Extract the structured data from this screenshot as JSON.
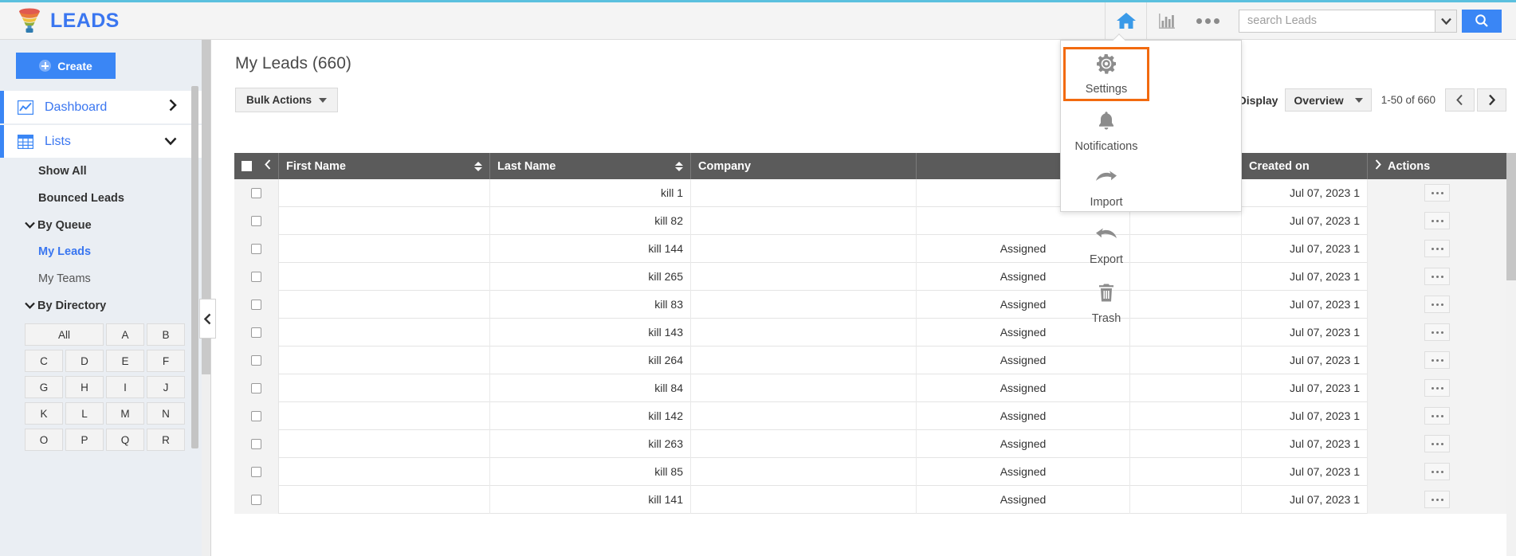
{
  "app": {
    "brand": "LEADS",
    "brand_color": "#3a76f0",
    "accent_color": "#3a86f5",
    "highlight_color": "#f26a0f",
    "top_border_color": "#5bc0de"
  },
  "topbar": {
    "home_icon": "home-icon",
    "reports_icon": "bar-chart-icon",
    "more_icon": "three-dots-icon",
    "search": {
      "placeholder": "search Leads",
      "value": "",
      "caret_icon": "chevron-down-icon",
      "submit_icon": "search-icon"
    }
  },
  "more_menu": {
    "items": [
      {
        "label": "Settings",
        "icon": "gear-icon",
        "selected": true
      },
      {
        "label": "Notifications",
        "icon": "bell-icon",
        "selected": false
      },
      {
        "label": "Import",
        "icon": "import-arrow-icon",
        "selected": false
      },
      {
        "label": "Export",
        "icon": "export-arrow-icon",
        "selected": false
      },
      {
        "label": "Trash",
        "icon": "trash-icon",
        "selected": false
      }
    ]
  },
  "sidebar": {
    "create_label": "Create",
    "nav": [
      {
        "label": "Dashboard",
        "icon": "line-chart-icon",
        "chevron": "›",
        "active": true
      },
      {
        "label": "Lists",
        "icon": "grid-icon",
        "chevron": "⌄",
        "active": true
      }
    ],
    "list_items": [
      {
        "label": "Show All",
        "style": "bold"
      },
      {
        "label": "Bounced Leads",
        "style": "bold"
      }
    ],
    "groups": [
      {
        "label": "By Queue",
        "caret": "⌄",
        "items": [
          {
            "label": "My Leads",
            "style": "link-blue"
          },
          {
            "label": "My Teams",
            "style": "plain"
          }
        ]
      },
      {
        "label": "By Directory",
        "caret": "⌄",
        "items": []
      }
    ],
    "directory_buttons": [
      "All",
      "A",
      "B",
      "C",
      "D",
      "E",
      "F",
      "G",
      "H",
      "I",
      "J",
      "K",
      "L",
      "M",
      "N",
      "O",
      "P",
      "Q",
      "R"
    ],
    "collapse_handle_icon": "chevron-left-icon"
  },
  "main": {
    "page_title": "My Leads (660)",
    "bulk_actions_label": "Bulk Actions",
    "display_label": "Display",
    "view_select": "Overview",
    "range_label": "1-50 of 660",
    "prev_icon": "chevron-left-icon",
    "next_icon": "chevron-right-icon"
  },
  "table": {
    "columns": [
      {
        "key": "checkbox",
        "label": "",
        "sortable": false
      },
      {
        "key": "first_name",
        "label": "First Name",
        "sortable": true
      },
      {
        "key": "last_name",
        "label": "Last Name",
        "sortable": true
      },
      {
        "key": "company",
        "label": "Company",
        "sortable": false
      },
      {
        "key": "status",
        "label": "",
        "sortable": false
      },
      {
        "key": "filter",
        "label": "",
        "sortable": true
      },
      {
        "key": "created_on",
        "label": "Created on",
        "sortable": false
      },
      {
        "key": "actions",
        "label": "Actions",
        "sortable": false
      }
    ],
    "header_collapse_icon": "chevron-left-icon",
    "header_expand_icon": "chevron-right-icon",
    "header_filter_icon": "filter-icon",
    "rows": [
      {
        "first_name": "",
        "last_name": "kill 1",
        "company": "",
        "status": "",
        "created_on": "Jul 07, 2023 1"
      },
      {
        "first_name": "",
        "last_name": "kill 82",
        "company": "",
        "status": "",
        "created_on": "Jul 07, 2023 1"
      },
      {
        "first_name": "",
        "last_name": "kill 144",
        "company": "",
        "status": "Assigned",
        "created_on": "Jul 07, 2023 1"
      },
      {
        "first_name": "",
        "last_name": "kill 265",
        "company": "",
        "status": "Assigned",
        "created_on": "Jul 07, 2023 1"
      },
      {
        "first_name": "",
        "last_name": "kill 83",
        "company": "",
        "status": "Assigned",
        "created_on": "Jul 07, 2023 1"
      },
      {
        "first_name": "",
        "last_name": "kill 143",
        "company": "",
        "status": "Assigned",
        "created_on": "Jul 07, 2023 1"
      },
      {
        "first_name": "",
        "last_name": "kill 264",
        "company": "",
        "status": "Assigned",
        "created_on": "Jul 07, 2023 1"
      },
      {
        "first_name": "",
        "last_name": "kill 84",
        "company": "",
        "status": "Assigned",
        "created_on": "Jul 07, 2023 1"
      },
      {
        "first_name": "",
        "last_name": "kill 142",
        "company": "",
        "status": "Assigned",
        "created_on": "Jul 07, 2023 1"
      },
      {
        "first_name": "",
        "last_name": "kill 263",
        "company": "",
        "status": "Assigned",
        "created_on": "Jul 07, 2023 1"
      },
      {
        "first_name": "",
        "last_name": "kill 85",
        "company": "",
        "status": "Assigned",
        "created_on": "Jul 07, 2023 1"
      },
      {
        "first_name": "",
        "last_name": "kill 141",
        "company": "",
        "status": "Assigned",
        "created_on": "Jul 07, 2023 1"
      }
    ],
    "row_action_icon": "three-dots-icon"
  }
}
